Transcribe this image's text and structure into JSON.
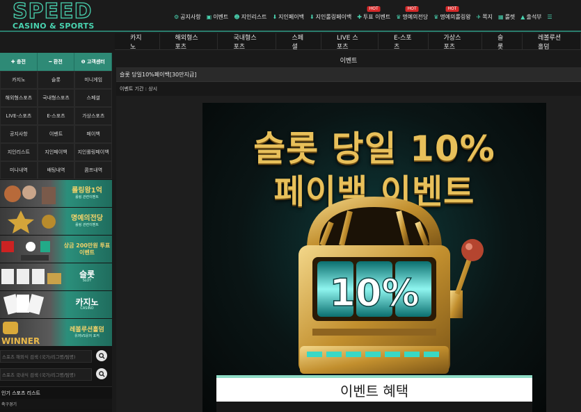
{
  "logo": {
    "main": "SPEED",
    "sub": "CASINO & SPORTS"
  },
  "topnav": [
    {
      "icon": "⚙",
      "label": "공지사항",
      "hot": ""
    },
    {
      "icon": "▣",
      "label": "이벤트",
      "hot": ""
    },
    {
      "icon": "☻",
      "label": "지인리스트",
      "hot": ""
    },
    {
      "icon": "⬇",
      "label": "지인페이백",
      "hot": ""
    },
    {
      "icon": "⬇",
      "label": "지인롤링페이백",
      "hot": ""
    },
    {
      "icon": "✚",
      "label": "투표 이벤트",
      "hot": "HOT"
    },
    {
      "icon": "♛",
      "label": "명예의전당",
      "hot": "HOT"
    },
    {
      "icon": "♛",
      "label": "명예의롤링왕",
      "hot": "HOT"
    },
    {
      "icon": "✈",
      "label": "쪽지",
      "hot": ""
    },
    {
      "icon": "▦",
      "label": "룰렛",
      "hot": ""
    },
    {
      "icon": "▲",
      "label": "출석부",
      "hot": ""
    },
    {
      "icon": "☰",
      "label": "",
      "hot": ""
    }
  ],
  "mainnav": [
    "카지노",
    "해외형스포츠",
    "국내형스포츠",
    "스페셜",
    "LIVE 스포츠",
    "E-스포츠",
    "가상스포츠",
    "슬롯",
    "레볼루션홀덤"
  ],
  "sidebar": {
    "top_buttons": [
      "✚ 충전",
      "━ 환전",
      "❶ 고객센터"
    ],
    "grid": [
      "카지노",
      "슬롯",
      "미니게임",
      "해외형스포츠",
      "국내형스포츠",
      "스페셜",
      "LIVE-스포츠",
      "E-스포츠",
      "가상스포츠",
      "공지사항",
      "이벤트",
      "페이백",
      "지인리스트",
      "지인페이백",
      "지인롤링페이백",
      "미니내역",
      "배팅내역",
      "콤프내역"
    ],
    "banners": [
      {
        "main": "롤링왕1억",
        "sub": "롤링 관련이벤트"
      },
      {
        "main": "명예의전당",
        "sub": "롤링 관련이벤트"
      },
      {
        "main": "상금 200만원 투표이벤트",
        "sub": ""
      },
      {
        "main": "슬롯",
        "sub": "SLOT"
      },
      {
        "main": "카지노",
        "sub": "CASINO"
      },
      {
        "main": "레볼루션홀덤",
        "sub": "유저VS유저 포커"
      }
    ],
    "search1": "스포츠 해외식 검색 (국가/리그명/팀명)",
    "search2": "스포츠 국내식 검색 (국가/리그명/팀명)",
    "popular_title": "인기 스포츠 리스트",
    "popular_item": "축구경기"
  },
  "content": {
    "title": "이벤트",
    "subject": "슬롯 당일10%페이백[30만지급]",
    "period": "이벤트 기간 : 상시",
    "poster": {
      "line1": "슬롯 당일 10%",
      "line2": "페이백 이벤트",
      "reel": "10%",
      "benefit": "이벤트 혜택"
    }
  },
  "colors": {
    "accent": "#2e8a76",
    "gold": "#e8c05a",
    "hot": "#d62a2a"
  }
}
